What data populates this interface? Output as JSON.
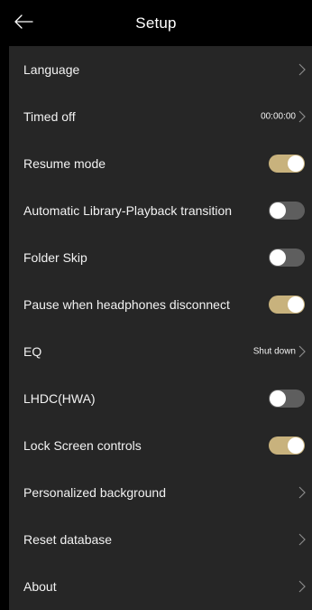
{
  "header": {
    "title": "Setup",
    "back_icon": "arrow-left-icon"
  },
  "accent_color": "#c8b27d",
  "settings": [
    {
      "id": "language",
      "label": "Language",
      "type": "nav"
    },
    {
      "id": "timed-off",
      "label": "Timed off",
      "type": "nav",
      "value": "00:00:00"
    },
    {
      "id": "resume-mode",
      "label": "Resume mode",
      "type": "toggle",
      "on": true
    },
    {
      "id": "auto-library-playback",
      "label": "Automatic Library-Playback transition",
      "type": "toggle",
      "on": false
    },
    {
      "id": "folder-skip",
      "label": "Folder Skip",
      "type": "toggle",
      "on": false
    },
    {
      "id": "pause-headphones",
      "label": "Pause when headphones disconnect",
      "type": "toggle",
      "on": true
    },
    {
      "id": "eq",
      "label": "EQ",
      "type": "nav",
      "value": "Shut down"
    },
    {
      "id": "lhdc",
      "label": "LHDC(HWA)",
      "type": "toggle",
      "on": false
    },
    {
      "id": "lock-screen",
      "label": "Lock Screen controls",
      "type": "toggle",
      "on": true
    },
    {
      "id": "personalized-bg",
      "label": "Personalized background",
      "type": "nav"
    },
    {
      "id": "reset-db",
      "label": "Reset database",
      "type": "nav"
    },
    {
      "id": "about",
      "label": "About",
      "type": "nav"
    }
  ]
}
